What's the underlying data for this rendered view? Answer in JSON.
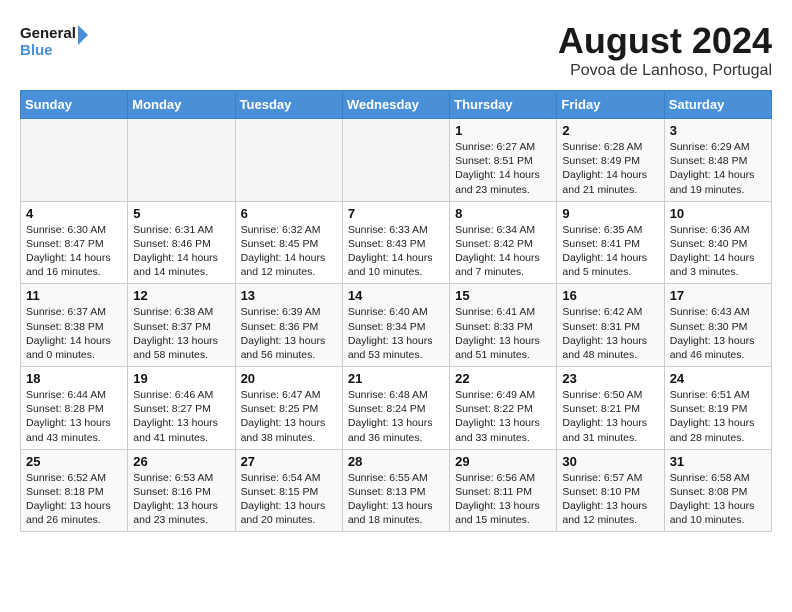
{
  "header": {
    "logo_line1": "General",
    "logo_line2": "Blue",
    "month_year": "August 2024",
    "location": "Povoa de Lanhoso, Portugal"
  },
  "weekdays": [
    "Sunday",
    "Monday",
    "Tuesday",
    "Wednesday",
    "Thursday",
    "Friday",
    "Saturday"
  ],
  "weeks": [
    [
      {
        "day": "",
        "info": ""
      },
      {
        "day": "",
        "info": ""
      },
      {
        "day": "",
        "info": ""
      },
      {
        "day": "",
        "info": ""
      },
      {
        "day": "1",
        "info": "Sunrise: 6:27 AM\nSunset: 8:51 PM\nDaylight: 14 hours\nand 23 minutes."
      },
      {
        "day": "2",
        "info": "Sunrise: 6:28 AM\nSunset: 8:49 PM\nDaylight: 14 hours\nand 21 minutes."
      },
      {
        "day": "3",
        "info": "Sunrise: 6:29 AM\nSunset: 8:48 PM\nDaylight: 14 hours\nand 19 minutes."
      }
    ],
    [
      {
        "day": "4",
        "info": "Sunrise: 6:30 AM\nSunset: 8:47 PM\nDaylight: 14 hours\nand 16 minutes."
      },
      {
        "day": "5",
        "info": "Sunrise: 6:31 AM\nSunset: 8:46 PM\nDaylight: 14 hours\nand 14 minutes."
      },
      {
        "day": "6",
        "info": "Sunrise: 6:32 AM\nSunset: 8:45 PM\nDaylight: 14 hours\nand 12 minutes."
      },
      {
        "day": "7",
        "info": "Sunrise: 6:33 AM\nSunset: 8:43 PM\nDaylight: 14 hours\nand 10 minutes."
      },
      {
        "day": "8",
        "info": "Sunrise: 6:34 AM\nSunset: 8:42 PM\nDaylight: 14 hours\nand 7 minutes."
      },
      {
        "day": "9",
        "info": "Sunrise: 6:35 AM\nSunset: 8:41 PM\nDaylight: 14 hours\nand 5 minutes."
      },
      {
        "day": "10",
        "info": "Sunrise: 6:36 AM\nSunset: 8:40 PM\nDaylight: 14 hours\nand 3 minutes."
      }
    ],
    [
      {
        "day": "11",
        "info": "Sunrise: 6:37 AM\nSunset: 8:38 PM\nDaylight: 14 hours\nand 0 minutes."
      },
      {
        "day": "12",
        "info": "Sunrise: 6:38 AM\nSunset: 8:37 PM\nDaylight: 13 hours\nand 58 minutes."
      },
      {
        "day": "13",
        "info": "Sunrise: 6:39 AM\nSunset: 8:36 PM\nDaylight: 13 hours\nand 56 minutes."
      },
      {
        "day": "14",
        "info": "Sunrise: 6:40 AM\nSunset: 8:34 PM\nDaylight: 13 hours\nand 53 minutes."
      },
      {
        "day": "15",
        "info": "Sunrise: 6:41 AM\nSunset: 8:33 PM\nDaylight: 13 hours\nand 51 minutes."
      },
      {
        "day": "16",
        "info": "Sunrise: 6:42 AM\nSunset: 8:31 PM\nDaylight: 13 hours\nand 48 minutes."
      },
      {
        "day": "17",
        "info": "Sunrise: 6:43 AM\nSunset: 8:30 PM\nDaylight: 13 hours\nand 46 minutes."
      }
    ],
    [
      {
        "day": "18",
        "info": "Sunrise: 6:44 AM\nSunset: 8:28 PM\nDaylight: 13 hours\nand 43 minutes."
      },
      {
        "day": "19",
        "info": "Sunrise: 6:46 AM\nSunset: 8:27 PM\nDaylight: 13 hours\nand 41 minutes."
      },
      {
        "day": "20",
        "info": "Sunrise: 6:47 AM\nSunset: 8:25 PM\nDaylight: 13 hours\nand 38 minutes."
      },
      {
        "day": "21",
        "info": "Sunrise: 6:48 AM\nSunset: 8:24 PM\nDaylight: 13 hours\nand 36 minutes."
      },
      {
        "day": "22",
        "info": "Sunrise: 6:49 AM\nSunset: 8:22 PM\nDaylight: 13 hours\nand 33 minutes."
      },
      {
        "day": "23",
        "info": "Sunrise: 6:50 AM\nSunset: 8:21 PM\nDaylight: 13 hours\nand 31 minutes."
      },
      {
        "day": "24",
        "info": "Sunrise: 6:51 AM\nSunset: 8:19 PM\nDaylight: 13 hours\nand 28 minutes."
      }
    ],
    [
      {
        "day": "25",
        "info": "Sunrise: 6:52 AM\nSunset: 8:18 PM\nDaylight: 13 hours\nand 26 minutes."
      },
      {
        "day": "26",
        "info": "Sunrise: 6:53 AM\nSunset: 8:16 PM\nDaylight: 13 hours\nand 23 minutes."
      },
      {
        "day": "27",
        "info": "Sunrise: 6:54 AM\nSunset: 8:15 PM\nDaylight: 13 hours\nand 20 minutes."
      },
      {
        "day": "28",
        "info": "Sunrise: 6:55 AM\nSunset: 8:13 PM\nDaylight: 13 hours\nand 18 minutes."
      },
      {
        "day": "29",
        "info": "Sunrise: 6:56 AM\nSunset: 8:11 PM\nDaylight: 13 hours\nand 15 minutes."
      },
      {
        "day": "30",
        "info": "Sunrise: 6:57 AM\nSunset: 8:10 PM\nDaylight: 13 hours\nand 12 minutes."
      },
      {
        "day": "31",
        "info": "Sunrise: 6:58 AM\nSunset: 8:08 PM\nDaylight: 13 hours\nand 10 minutes."
      }
    ]
  ]
}
